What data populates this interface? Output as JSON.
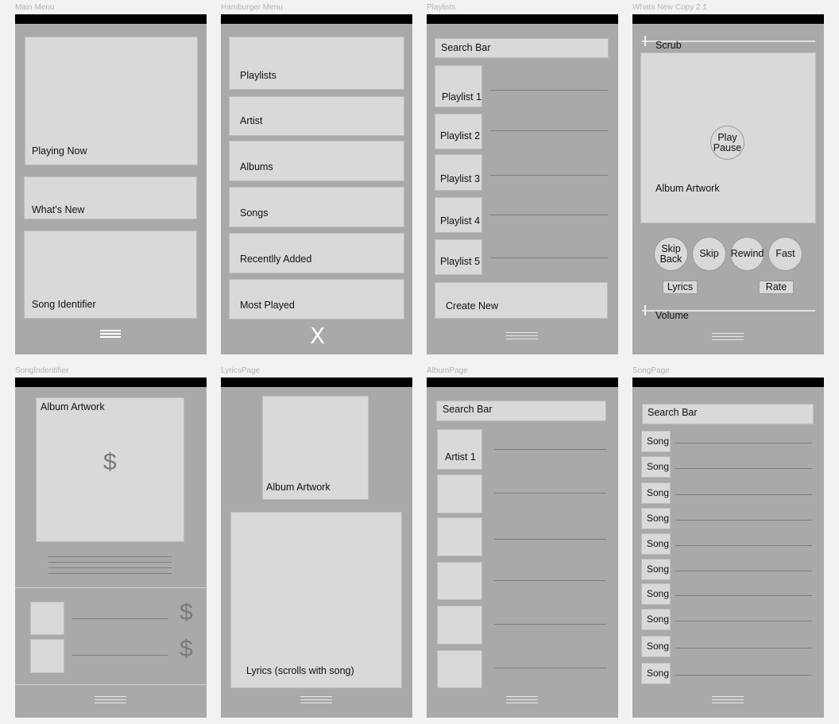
{
  "titles": {
    "main_menu": "Main Menu",
    "hamburger": "Hamburger Menu",
    "playlists": "Playlists",
    "whats_new": "Whats New Copy 2.1",
    "song_identifier": "SongIndentifier",
    "lyrics_page": "LyricsPage",
    "album_page": "AlbumPage",
    "song_page": "SongPage"
  },
  "main_menu": {
    "playing_now": "Playing Now",
    "whats_new": "What’s New",
    "song_identifier": "Song Identifier",
    "menu_icon": "hamburger-icon"
  },
  "hamburger": {
    "items": [
      "Playlists",
      "Artist",
      "Albums",
      "Songs",
      "Recentlly Added",
      "Most Played"
    ],
    "close": "X"
  },
  "playlists": {
    "search": "Search Bar",
    "items": [
      "Playlist 1",
      "Playlist 2",
      "Playlist 3",
      "Playlist 4",
      "Playlist 5"
    ],
    "create_new": "Create New"
  },
  "whats_new": {
    "scrub": "Scrub",
    "play_pause": "Play Pause",
    "album_artwork": "Album Artwork",
    "skip_back": "Skip Back",
    "skip": "Skip",
    "rewind": "Rewind",
    "fast": "Fast",
    "lyrics": "Lyrics",
    "rate": "Rate",
    "volume": "Volume"
  },
  "song_identifier": {
    "album_artwork": "Album Artwork",
    "price_symbol": "$"
  },
  "lyrics_page": {
    "album_artwork": "Album Artwork",
    "lyrics": "Lyrics (scrolls with song)"
  },
  "album_page": {
    "search": "Search Bar",
    "artist": "Artist 1"
  },
  "song_page": {
    "search": "Search Bar",
    "song_label": "Song",
    "song_count": 10
  }
}
